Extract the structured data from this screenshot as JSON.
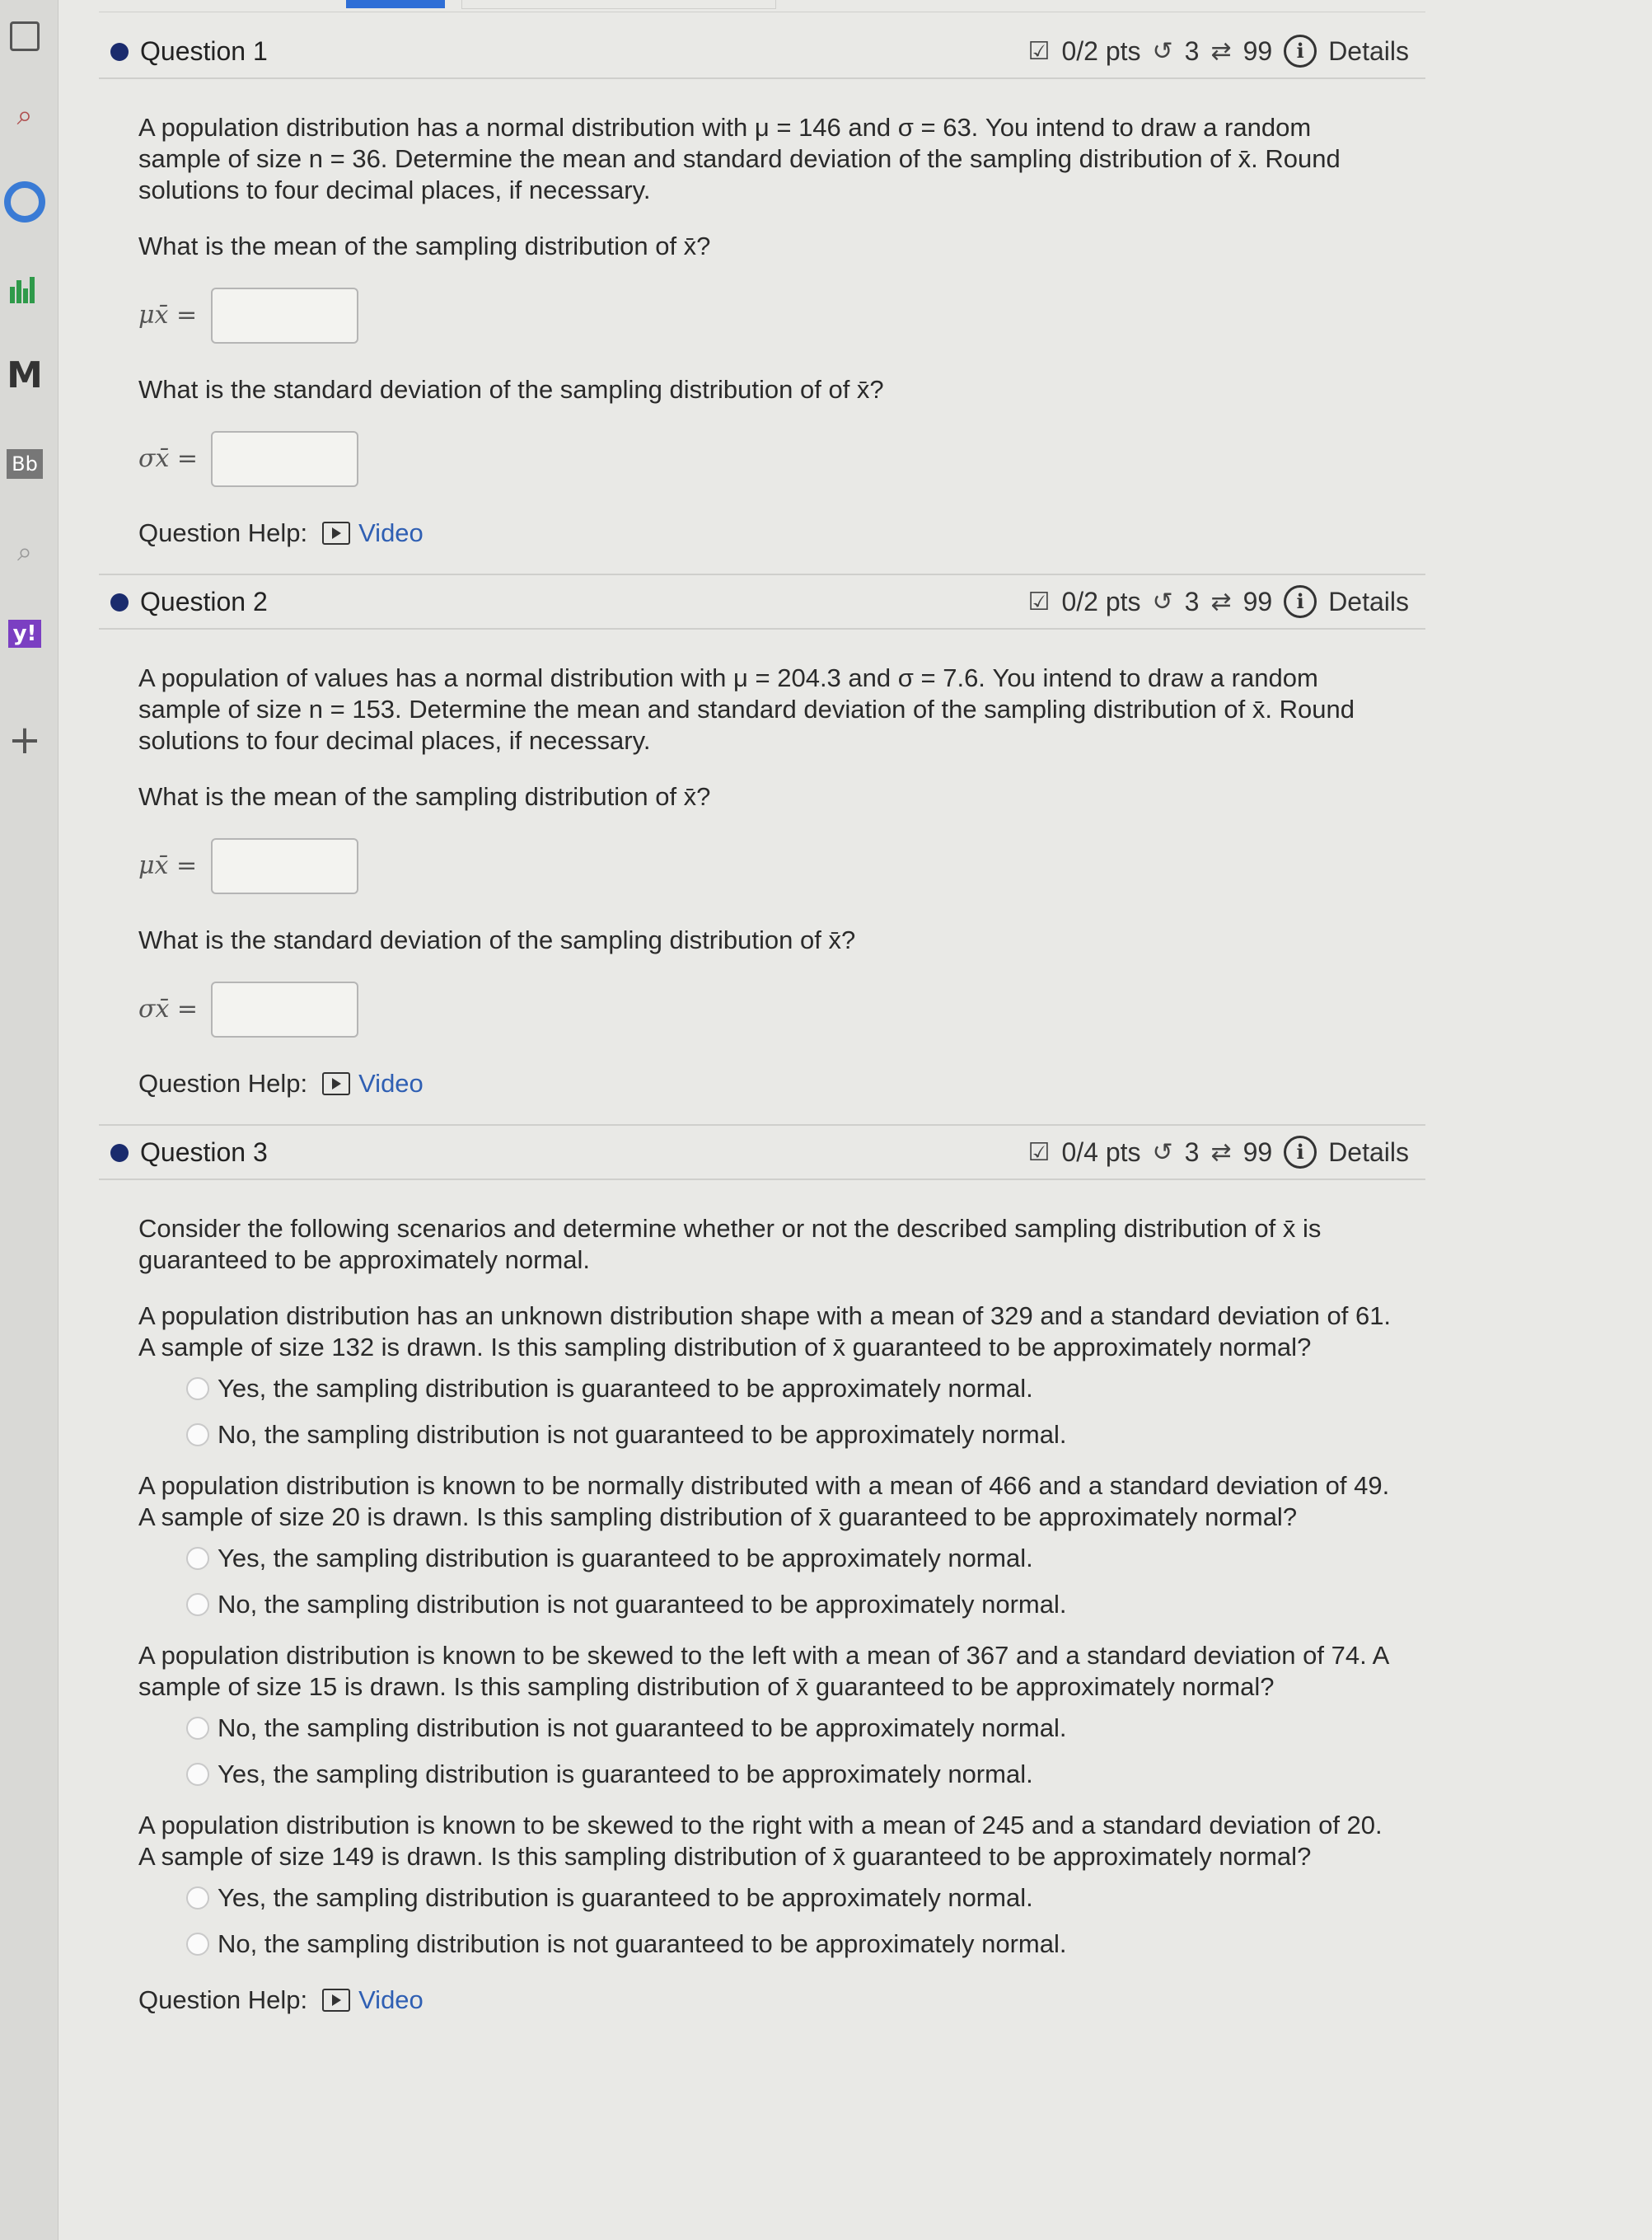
{
  "questions": [
    {
      "title": "Question 1",
      "points": "0/2 pts",
      "attempts": "3",
      "retries": "99",
      "details_label": "Details",
      "intro": "A population distribution has a normal distribution with μ = 146 and σ = 63. You intend to draw a random sample of size n = 36. Determine the mean and standard deviation of the sampling distribution of x̄. Round solutions to four decimal places, if necessary.",
      "prompt_mean": "What is the mean of the sampling distribution of x̄?",
      "mean_label": "μx̄ =",
      "mean_value": "",
      "prompt_sd": "What is the standard deviation of the sampling distribution of of x̄?",
      "sd_label": "σx̄ =",
      "sd_value": "",
      "help_label": "Question Help:",
      "video_label": "Video"
    },
    {
      "title": "Question 2",
      "points": "0/2 pts",
      "attempts": "3",
      "retries": "99",
      "details_label": "Details",
      "intro": "A population of values has a normal distribution with μ = 204.3 and σ = 7.6. You intend to draw a random sample of size n = 153. Determine the mean and standard deviation of the sampling distribution of x̄. Round solutions to four decimal places, if necessary.",
      "prompt_mean": "What is the mean of the sampling distribution of x̄?",
      "mean_label": "μx̄ =",
      "mean_value": "",
      "prompt_sd": "What is the standard deviation of the sampling distribution of x̄?",
      "sd_label": "σx̄ =",
      "sd_value": "",
      "help_label": "Question Help:",
      "video_label": "Video"
    },
    {
      "title": "Question 3",
      "points": "0/4 pts",
      "attempts": "3",
      "retries": "99",
      "details_label": "Details",
      "intro": "Consider the following scenarios and determine whether or not the described sampling distribution of x̄ is guaranteed to be approximately normal.",
      "scenarios": [
        {
          "text": "A population distribution has an unknown distribution shape with a mean of 329 and a standard deviation of 61. A sample of size 132 is drawn. Is this sampling distribution of x̄ guaranteed to be approximately normal?",
          "options": [
            "Yes, the sampling distribution is guaranteed to be approximately normal.",
            "No, the sampling distribution is not guaranteed to be approximately normal."
          ]
        },
        {
          "text": "A population distribution is known to be normally distributed with a mean of 466 and a standard deviation of 49. A sample of size 20 is drawn. Is this sampling distribution of x̄ guaranteed to be approximately normal?",
          "options": [
            "Yes, the sampling distribution is guaranteed to be approximately normal.",
            "No, the sampling distribution is not guaranteed to be approximately normal."
          ]
        },
        {
          "text": "A population distribution is known to be skewed to the left with a mean of 367 and a standard deviation of 74. A sample of size 15 is drawn. Is this sampling distribution of x̄ guaranteed to be approximately normal?",
          "options": [
            "No, the sampling distribution is not guaranteed to be approximately normal.",
            "Yes, the sampling distribution is guaranteed to be approximately normal."
          ]
        },
        {
          "text": "A population distribution is known to be skewed to the right with a mean of 245 and a standard deviation of 20. A sample of size 149 is drawn. Is this sampling distribution of x̄ guaranteed to be approximately normal?",
          "options": [
            "Yes, the sampling distribution is guaranteed to be approximately normal.",
            "No, the sampling distribution is not guaranteed to be approximately normal."
          ]
        }
      ],
      "help_label": "Question Help:",
      "video_label": "Video"
    }
  ],
  "sidebar": {
    "icons": [
      "square-icon",
      "search-icon",
      "circle-icon",
      "chart-icon",
      "m-icon",
      "bb-icon",
      "search-icon",
      "yahoo-icon",
      "plus-icon"
    ],
    "bb_label": "Bb",
    "m_label": "M",
    "y_label": "y!",
    "plus_label": "+"
  }
}
